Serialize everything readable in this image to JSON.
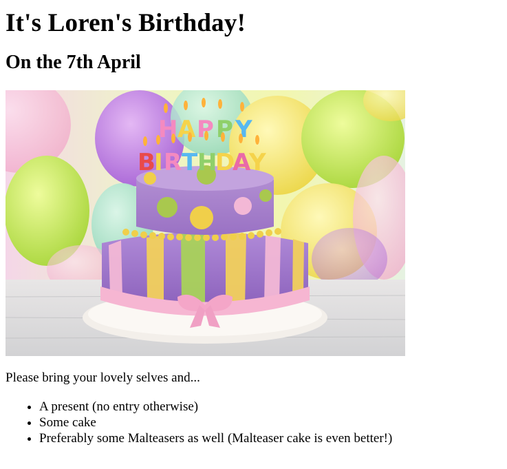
{
  "heading": "It's Loren's Birthday!",
  "subheading": "On the 7th April",
  "image": {
    "cake_text_top": "HAPPY",
    "cake_text_bottom": "BIRTHDAY"
  },
  "intro": "Please bring your lovely selves and...",
  "items": [
    "A present (no entry otherwise)",
    "Some cake",
    "Preferably some Malteasers as well (Malteaser cake is even better!)"
  ]
}
